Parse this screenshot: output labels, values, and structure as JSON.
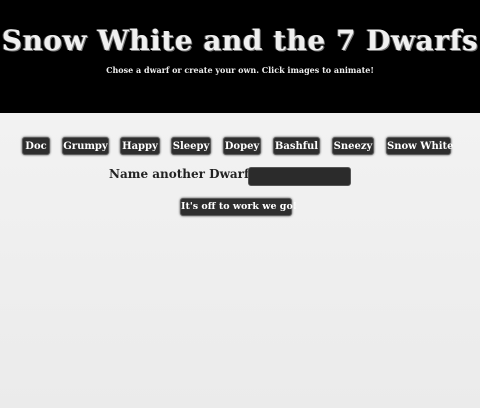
{
  "header": {
    "title": "Snow White and the 7 Dwarfs",
    "subtitle": "Chose a dwarf or create your own. Click images to animate!"
  },
  "dwarf_buttons": [
    {
      "label": "Doc"
    },
    {
      "label": "Grumpy"
    },
    {
      "label": "Happy"
    },
    {
      "label": "Sleepy"
    },
    {
      "label": "Dopey"
    },
    {
      "label": "Bashful"
    },
    {
      "label": "Sneezy"
    },
    {
      "label": "Snow White"
    }
  ],
  "name_form": {
    "label": "Name another Dwarf",
    "value": "",
    "submit_label": "It's off to work we go!"
  }
}
